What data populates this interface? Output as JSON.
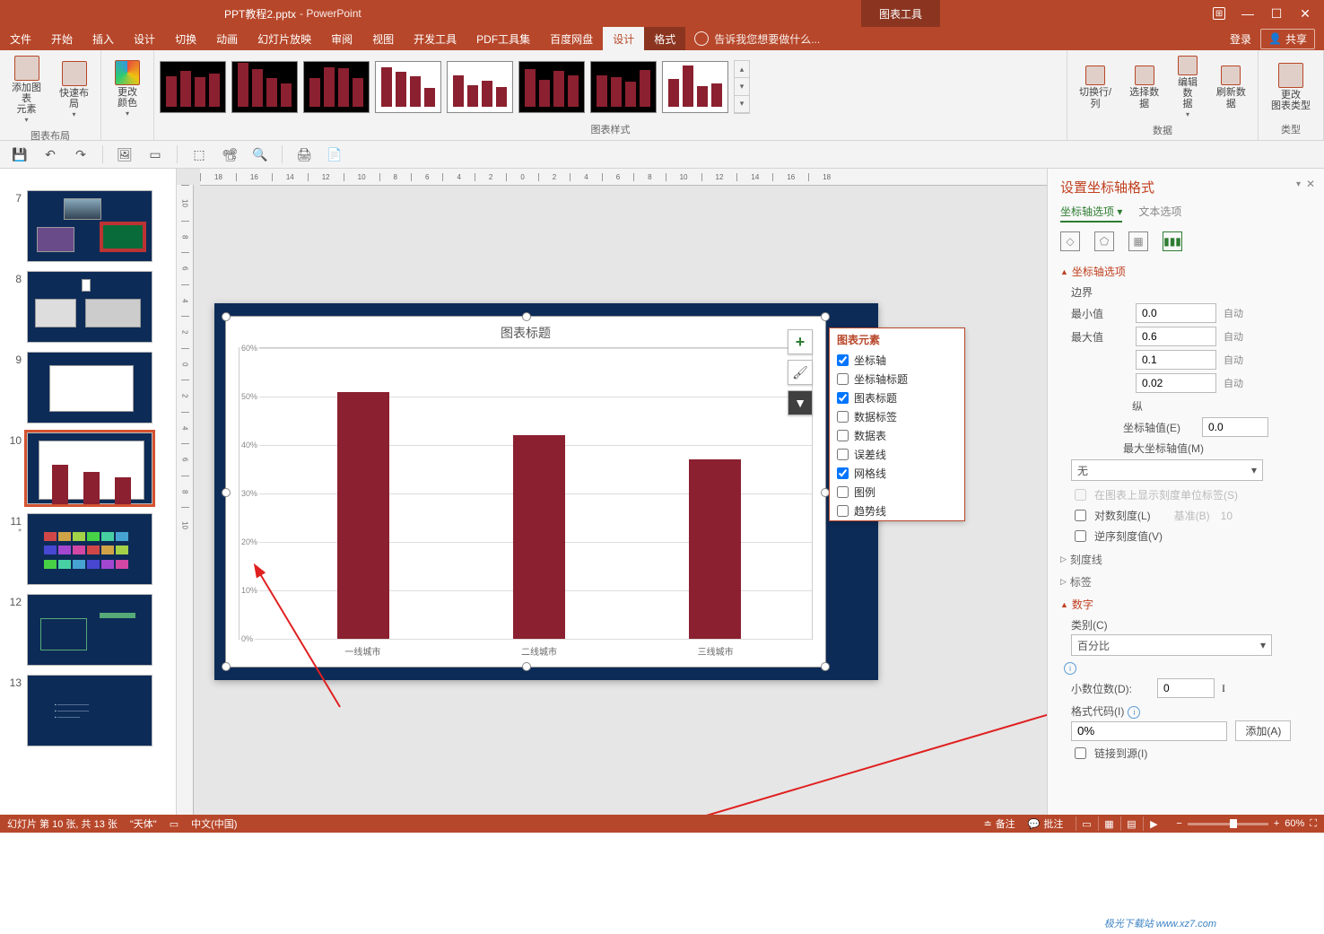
{
  "title": {
    "doc": "PPT教程2.pptx",
    "app": " - PowerPoint",
    "context_tab": "图表工具"
  },
  "window_buttons": {
    "ribbon_opts": "⊞",
    "min": "—",
    "max": "☐",
    "close": "✕"
  },
  "menubar": {
    "tabs": [
      "文件",
      "开始",
      "插入",
      "设计",
      "切换",
      "动画",
      "幻灯片放映",
      "审阅",
      "视图",
      "开发工具",
      "PDF工具集",
      "百度网盘",
      "设计",
      "格式"
    ],
    "active_index": 12,
    "tellme": "告诉我您想要做什么...",
    "login": "登录",
    "share": "共享"
  },
  "ribbon": {
    "layout_group": {
      "label": "图表布局",
      "add_element": "添加图表\n元素",
      "quick_layout": "快速布局"
    },
    "colors": {
      "label": "更改\n颜色"
    },
    "styles_group": {
      "label": "图表样式"
    },
    "data_group": {
      "label": "数据",
      "switch": "切换行/列",
      "select": "选择数据",
      "edit": "编辑数\n据",
      "refresh": "刷新数据"
    },
    "type_group": {
      "label": "类型",
      "change": "更改\n图表类型"
    }
  },
  "qat": {
    "save": "💾",
    "undo": "↶",
    "redo": "↷"
  },
  "thumbs": {
    "visible_start": 7,
    "active": 10,
    "star_on": 11,
    "count": 13
  },
  "ruler": {
    "h": [
      "18",
      "16",
      "14",
      "12",
      "10",
      "8",
      "6",
      "4",
      "2",
      "0",
      "2",
      "4",
      "6",
      "8",
      "10",
      "12",
      "14",
      "16",
      "18"
    ],
    "v": [
      "10",
      "8",
      "6",
      "4",
      "2",
      "0",
      "2",
      "4",
      "6",
      "8",
      "10"
    ]
  },
  "chart_data": {
    "type": "bar",
    "title": "图表标题",
    "categories": [
      "一线城市",
      "二线城市",
      "三线城市"
    ],
    "values": [
      0.51,
      0.42,
      0.37
    ],
    "ylim": [
      0,
      0.6
    ],
    "yticks": [
      "0%",
      "10%",
      "20%",
      "30%",
      "40%",
      "50%",
      "60%"
    ]
  },
  "chart_side_buttons": {
    "plus": "+",
    "brush": "🖌",
    "filter": "▼"
  },
  "flyout": {
    "title": "图表元素",
    "items": [
      {
        "label": "坐标轴",
        "checked": true
      },
      {
        "label": "坐标轴标题",
        "checked": false
      },
      {
        "label": "图表标题",
        "checked": true
      },
      {
        "label": "数据标签",
        "checked": false
      },
      {
        "label": "数据表",
        "checked": false
      },
      {
        "label": "误差线",
        "checked": false
      },
      {
        "label": "网格线",
        "checked": true
      },
      {
        "label": "图例",
        "checked": false
      },
      {
        "label": "趋势线",
        "checked": false
      }
    ]
  },
  "pane": {
    "title": "设置坐标轴格式",
    "tabs": {
      "axis": "坐标轴选项",
      "text": "文本选项"
    },
    "section_axis_options": "坐标轴选项",
    "bounds": {
      "label": "边界",
      "min_label": "最小值",
      "min": "0.0",
      "min_mode": "自动",
      "max_label": "最大值",
      "max": "0.6",
      "max_mode": "自动"
    },
    "units": {
      "major": "0.1",
      "major_mode": "自动",
      "minor": "0.02",
      "minor_mode": "自动"
    },
    "cross": {
      "header": "纵",
      "cross_label": "坐标轴值(E)",
      "cross_val": "0.0",
      "max_axis": "最大坐标轴值(M)"
    },
    "display_units": {
      "none": "无",
      "show_label": "在图表上显示刻度单位标签(S)"
    },
    "log": {
      "label": "对数刻度(L)",
      "base_label": "基准(B)",
      "base": "10"
    },
    "reverse": "逆序刻度值(V)",
    "ticks": "刻度线",
    "labels": "标签",
    "number": {
      "header": "数字",
      "category_label": "类别(C)",
      "category": "百分比",
      "decimals_label": "小数位数(D):",
      "decimals": "0",
      "format_label": "格式代码(I)",
      "format": "0%",
      "add": "添加(A)",
      "link": "链接到源(I)"
    }
  },
  "statusbar": {
    "slide_info": "幻灯片 第 10 张, 共 13 张",
    "theme": "\"天体\"",
    "lang": "中文(中国)",
    "notes": "备注",
    "comments": "批注",
    "zoom": "60%",
    "watermark": "极光下载站 www.xz7.com"
  }
}
